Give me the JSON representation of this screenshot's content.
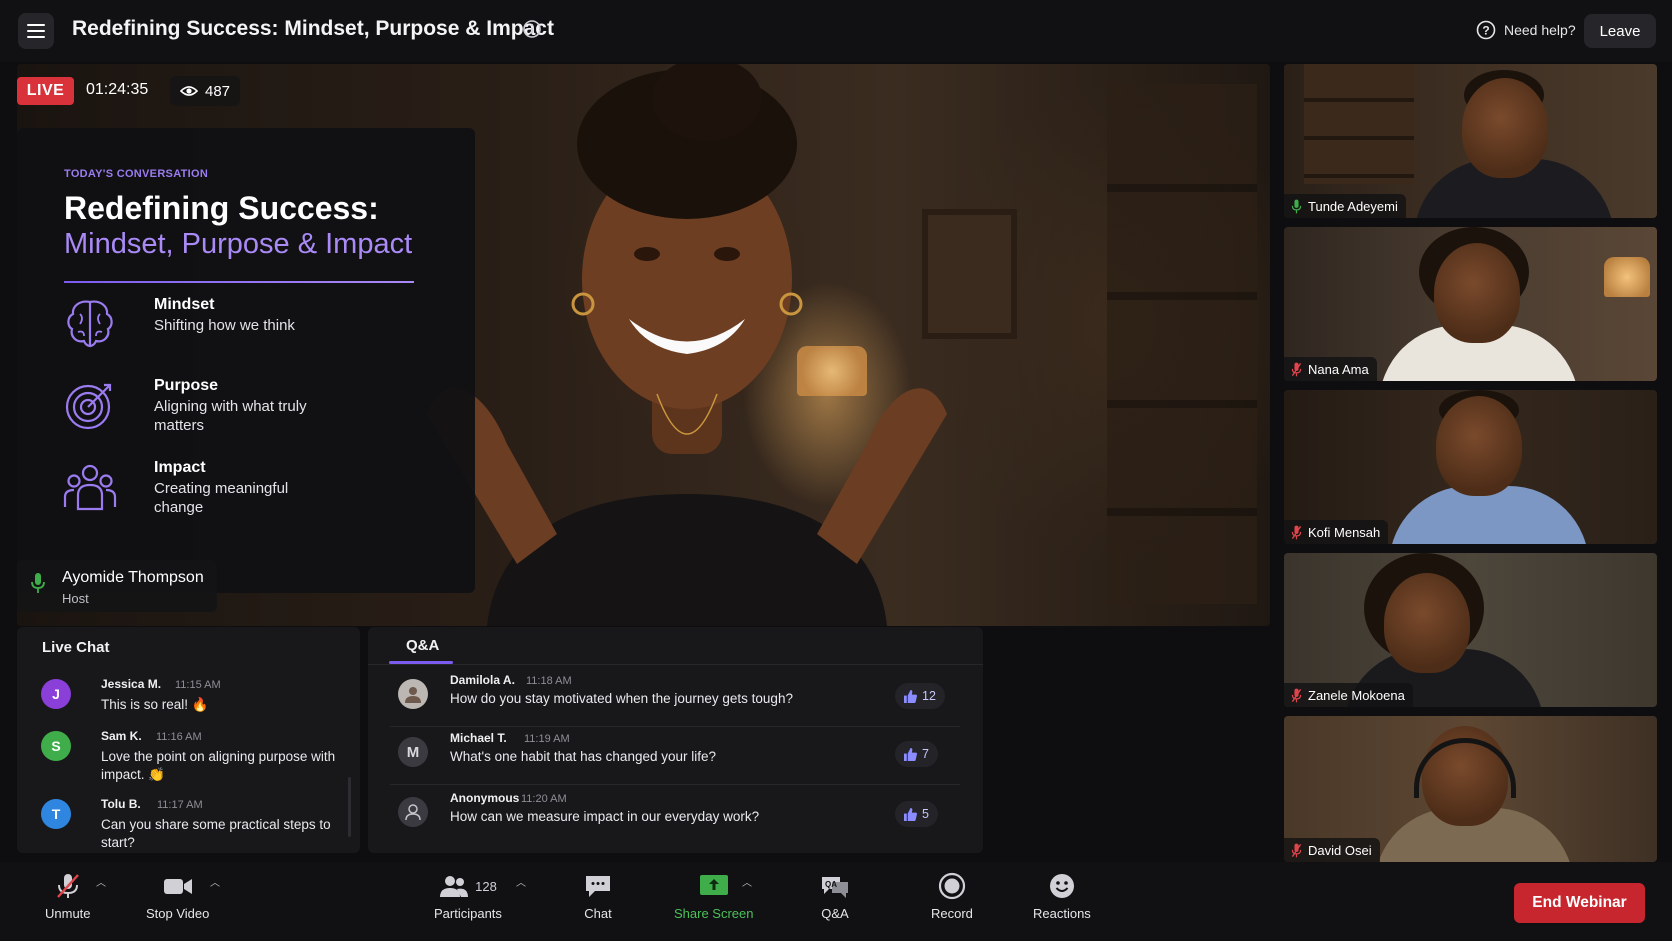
{
  "header": {
    "title": "Redefining Success: Mindset, Purpose & Impact",
    "help_label": "Need help?",
    "leave_label": "Leave"
  },
  "stream": {
    "live_label": "LIVE",
    "elapsed": "01:24:35",
    "viewer_count": "487"
  },
  "slide": {
    "eyebrow": "TODAY'S CONVERSATION",
    "title_line1": "Redefining Success:",
    "title_line2": "Mindset, Purpose & Impact",
    "pillars": [
      {
        "title": "Mindset",
        "desc": "Shifting how we think",
        "icon": "brain-icon"
      },
      {
        "title": "Purpose",
        "desc": "Aligning with what truly matters",
        "icon": "target-icon"
      },
      {
        "title": "Impact",
        "desc": "Creating meaningful change",
        "icon": "people-icon"
      }
    ]
  },
  "host": {
    "name": "Ayomide Thompson",
    "role": "Host"
  },
  "participants": [
    {
      "name": "Tunde Adeyemi",
      "mic": "on"
    },
    {
      "name": "Nana Ama",
      "mic": "muted"
    },
    {
      "name": "Kofi Mensah",
      "mic": "muted"
    },
    {
      "name": "Zanele Mokoena",
      "mic": "muted"
    },
    {
      "name": "David Osei",
      "mic": "muted"
    }
  ],
  "chat": {
    "title": "Live Chat",
    "messages": [
      {
        "initial": "J",
        "name": "Jessica M.",
        "time": "11:15 AM",
        "text": "This is so real! 🔥",
        "color": "#8b3fd9"
      },
      {
        "initial": "S",
        "name": "Sam K.",
        "time": "11:16 AM",
        "text": "Love the point on aligning purpose with impact. 👏",
        "color": "#3fae4a"
      },
      {
        "initial": "T",
        "name": "Tolu B.",
        "time": "11:17 AM",
        "text": "Can you share some practical steps to start?",
        "color": "#2f86e0"
      }
    ]
  },
  "qa": {
    "tab_label": "Q&A",
    "questions": [
      {
        "avatar": "photo",
        "name": "Damilola A.",
        "time": "11:18 AM",
        "text": "How do you stay motivated when the journey gets tough?",
        "upvotes": "12"
      },
      {
        "avatar": "M",
        "name": "Michael T.",
        "time": "11:19 AM",
        "text": "What's one habit that has changed your life?",
        "upvotes": "7"
      },
      {
        "avatar": "anon",
        "name": "Anonymous",
        "time": "11:20 AM",
        "text": "How can we measure impact in our everyday work?",
        "upvotes": "5"
      }
    ]
  },
  "toolbar": {
    "unmute_label": "Unmute",
    "stop_video_label": "Stop Video",
    "participants_label": "Participants",
    "participants_count": "128",
    "chat_label": "Chat",
    "share_screen_label": "Share Screen",
    "qa_label": "Q&A",
    "record_label": "Record",
    "reactions_label": "Reactions",
    "end_label": "End Webinar"
  },
  "colors": {
    "accent": "#7c5cf0",
    "live_red": "#d9323a",
    "end_red": "#c8262e",
    "share_green": "#3fae4a"
  }
}
